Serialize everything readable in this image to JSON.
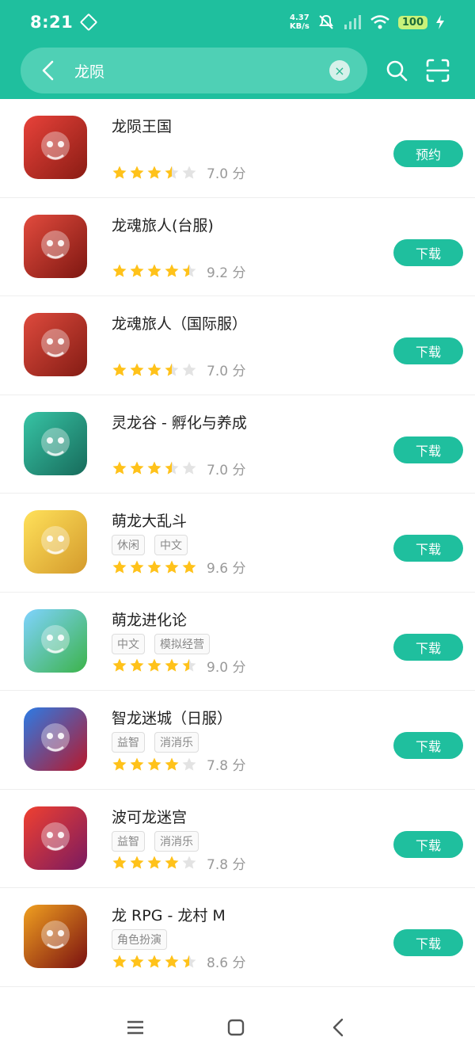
{
  "status": {
    "time": "8:21",
    "net_speed_top": "4.37",
    "net_speed_unit": "KB/s",
    "battery": "100"
  },
  "search": {
    "query": "龙陨",
    "back_icon": "back-arrow-icon",
    "clear_icon": "clear-icon",
    "search_icon": "search-icon",
    "scan_icon": "scan-icon"
  },
  "colors": {
    "accent": "#1fbf9e",
    "star": "#ffc21a",
    "star_empty": "#e3e3e3"
  },
  "apps": [
    {
      "title": "龙陨王国",
      "tags": [],
      "rating": 3.5,
      "score": "7.0 分",
      "action": "预约"
    },
    {
      "title": "龙魂旅人(台服)",
      "tags": [],
      "rating": 4.5,
      "score": "9.2 分",
      "action": "下载"
    },
    {
      "title": "龙魂旅人（国际服）",
      "tags": [],
      "rating": 3.5,
      "score": "7.0 分",
      "action": "下载"
    },
    {
      "title": "灵龙谷 - 孵化与养成",
      "tags": [],
      "rating": 3.5,
      "score": "7.0 分",
      "action": "下载"
    },
    {
      "title": "萌龙大乱斗",
      "tags": [
        "休闲",
        "中文"
      ],
      "rating": 5,
      "score": "9.6 分",
      "action": "下载"
    },
    {
      "title": "萌龙进化论",
      "tags": [
        "中文",
        "模拟经营"
      ],
      "rating": 4.5,
      "score": "9.0 分",
      "action": "下载"
    },
    {
      "title": "智龙迷城（日服）",
      "tags": [
        "益智",
        "消消乐"
      ],
      "rating": 4,
      "score": "7.8 分",
      "action": "下载"
    },
    {
      "title": "波可龙迷宫",
      "tags": [
        "益智",
        "消消乐"
      ],
      "rating": 4,
      "score": "7.8 分",
      "action": "下载"
    },
    {
      "title": "龙 RPG - 龙村 M",
      "tags": [
        "角色扮演"
      ],
      "rating": 4.5,
      "score": "8.6 分",
      "action": "下载"
    }
  ],
  "icon_styles": [
    "linear-gradient(135deg,#e8423a,#8a1c14)",
    "linear-gradient(135deg,#e24b3e,#7e1711)",
    "linear-gradient(135deg,#de4a3d,#841c14)",
    "linear-gradient(135deg,#37c4a5,#176b5b)",
    "linear-gradient(135deg,#ffe15a,#d49a2c)",
    "linear-gradient(135deg,#7fd3ff,#3cb34a)",
    "linear-gradient(135deg,#2c7be5,#b8182b)",
    "linear-gradient(135deg,#f04030,#7a1a60)",
    "linear-gradient(135deg,#f0a020,#7a1010)"
  ],
  "navbar": {
    "menu_icon": "menu-icon",
    "home_icon": "home-icon",
    "back_icon": "nav-back-icon"
  }
}
